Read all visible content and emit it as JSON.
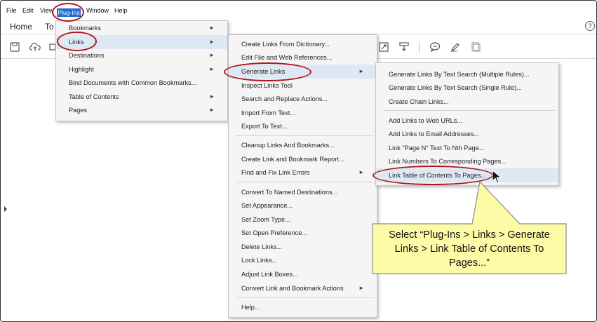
{
  "menubar": {
    "file": "File",
    "edit": "Edit",
    "view": "View",
    "plugins": "Plug-Ins",
    "window": "Window",
    "help": "Help"
  },
  "titlebar": {
    "home": "Home",
    "tools": "To",
    "help_icon": "?"
  },
  "toolbar_icons": [
    "save-icon",
    "upload-cloud-icon",
    "print-icon",
    "fit-page-icon",
    "download-icon",
    "comment-icon",
    "pen-icon",
    "stamp-icon"
  ],
  "plugins_menu": {
    "items": [
      {
        "label": "Bookmarks",
        "has_submenu": true
      },
      {
        "label": "Links",
        "has_submenu": true
      },
      {
        "label": "Destinations",
        "has_submenu": true
      },
      {
        "label": "Highlight",
        "has_submenu": true
      },
      {
        "label": "Bind Documents with Common Bookmarks...",
        "has_submenu": false
      },
      {
        "label": "Table of Contents",
        "has_submenu": true
      },
      {
        "label": "Pages",
        "has_submenu": true
      }
    ]
  },
  "links_menu": {
    "items": [
      {
        "label": "Create Links From Dictionary..."
      },
      {
        "label": "Edit File and Web References..."
      },
      {
        "label": "Generate Links",
        "has_submenu": true
      },
      {
        "label": "Inspect Links Tool"
      },
      {
        "label": "Search and Replace Actions..."
      },
      {
        "label": "Import From Text..."
      },
      {
        "label": "Export To Text..."
      },
      {
        "label": "Cleanup Links And Bookmarks..."
      },
      {
        "label": "Create Link and Bookmark Report..."
      },
      {
        "label": "Find and Fix Link Errors",
        "has_submenu": true
      },
      {
        "label": "Convert To Named Destinations..."
      },
      {
        "label": "Set Appearance..."
      },
      {
        "label": "Set Zoom Type..."
      },
      {
        "label": "Set Open Preference..."
      },
      {
        "label": "Delete Links..."
      },
      {
        "label": "Lock Links..."
      },
      {
        "label": "Adjust Link Boxes..."
      },
      {
        "label": "Convert Link and Bookmark Actions",
        "has_submenu": true
      },
      {
        "label": "Help..."
      }
    ]
  },
  "generate_menu": {
    "items": [
      {
        "label": "Generate Links By Text Search (Multiple Rules)..."
      },
      {
        "label": "Generate Links By Text Search (Single Rule)..."
      },
      {
        "label": "Create Chain Links..."
      },
      {
        "label": "Add Links to Web URLs..."
      },
      {
        "label": "Add Links to Email Addresses..."
      },
      {
        "label": "Link \"Page N\" Text To Nth Page..."
      },
      {
        "label": "Link Numbers To Corresponding Pages..."
      },
      {
        "label": "Link Table of Contents To Pages..."
      }
    ]
  },
  "callout": {
    "text": "Select “Plug-Ins > Links > Generate Links > Link Table of Contents To Pages...”"
  },
  "colors": {
    "highlight_blue": "#1f6fd1",
    "oval_red": "#b3151b",
    "callout_fill": "#fdfba6",
    "menu_hover": "#dde8f4"
  }
}
